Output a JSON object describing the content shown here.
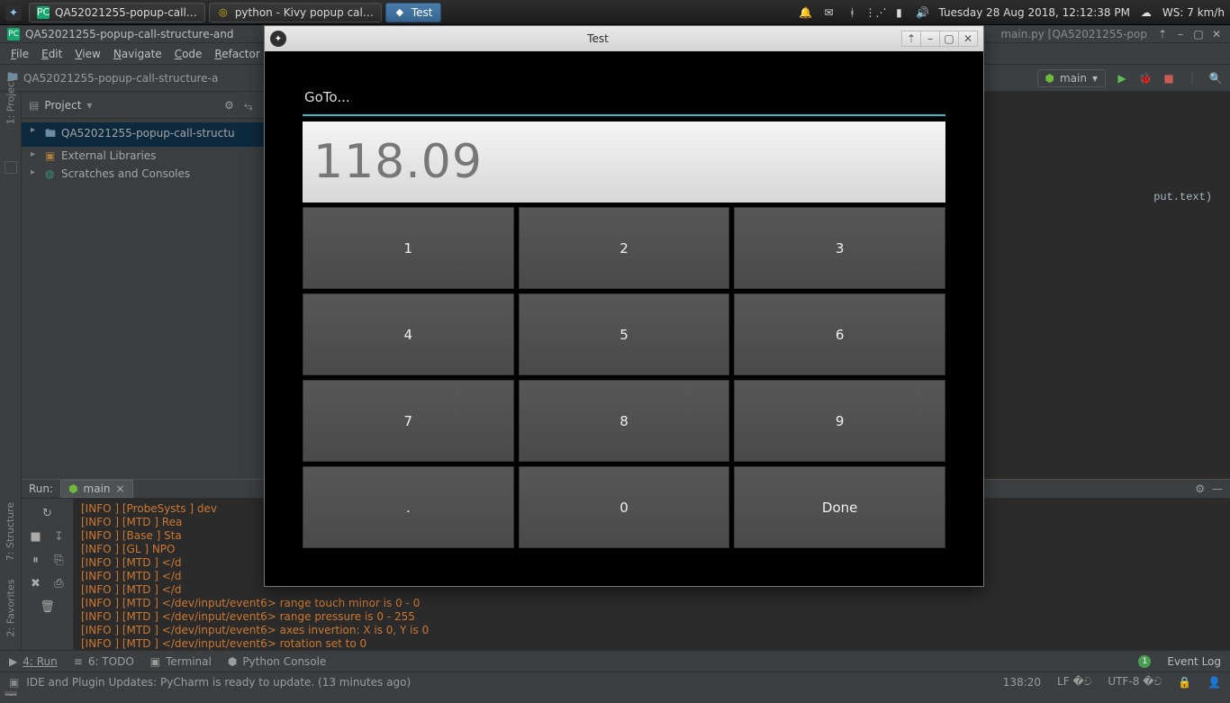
{
  "taskbar": {
    "apps": [
      {
        "icon": "PC",
        "label": "QA52021255-popup-call…"
      },
      {
        "icon": "◎",
        "label": "python - Kivy popup cal…"
      },
      {
        "icon": "◆",
        "label": "Test"
      }
    ],
    "clock": "Tuesday 28 Aug 2018, 12:12:38 PM",
    "weather": "WS: 7 km/h"
  },
  "ide": {
    "title_left": "QA52021255-popup-call-structure-and",
    "title_right": "main.py [QA52021255-pop",
    "menu": [
      "File",
      "Edit",
      "View",
      "Navigate",
      "Code",
      "Refactor"
    ],
    "breadcrumb": "QA52021255-popup-call-structure-a",
    "run_config": "main",
    "project_panel": {
      "header": "Project",
      "items": [
        "QA52021255-popup-call-structu",
        "External Libraries",
        "Scratches and Consoles"
      ]
    },
    "left_gutter": [
      "1: Project"
    ],
    "left_gutter_bottom": [
      "7: Structure",
      "2: Favorites"
    ],
    "editor_hint": "put.text)"
  },
  "run": {
    "label": "Run:",
    "tab_name": "main",
    "lines": [
      "[INFO   ] [ProbeSysts  ] dev",
      "[INFO   ] [MTD         ] Rea",
      "[INFO   ] [Base        ] Sta",
      "[INFO   ] [GL          ] NPO",
      "[INFO   ] [MTD         ] </d",
      "[INFO   ] [MTD         ] </d",
      "[INFO   ] [MTD         ] </d",
      "[INFO   ] [MTD         ] </dev/input/event6> range touch minor is 0 - 0",
      "[INFO   ] [MTD         ] </dev/input/event6> range pressure is 0 - 255",
      "[INFO   ] [MTD         ] </dev/input/event6> axes invertion: X is 0, Y is 0",
      "[INFO   ] [MTD         ] </dev/input/event6> rotation set to 0"
    ]
  },
  "tool_strip": {
    "items": [
      "4: Run",
      "6: TODO",
      "Terminal",
      "Python Console"
    ],
    "event_log": "Event Log"
  },
  "status": {
    "msg": "IDE and Plugin Updates: PyCharm is ready to update. (13 minutes ago)",
    "pos": "138:20",
    "le": "LF",
    "enc": "UTF-8"
  },
  "popup": {
    "window_title": "Test",
    "label": "GoTo...",
    "display": "118.09",
    "keys": [
      "1",
      "2",
      "3",
      "4",
      "5",
      "6",
      "7",
      "8",
      "9",
      ".",
      "0",
      "Done"
    ]
  }
}
